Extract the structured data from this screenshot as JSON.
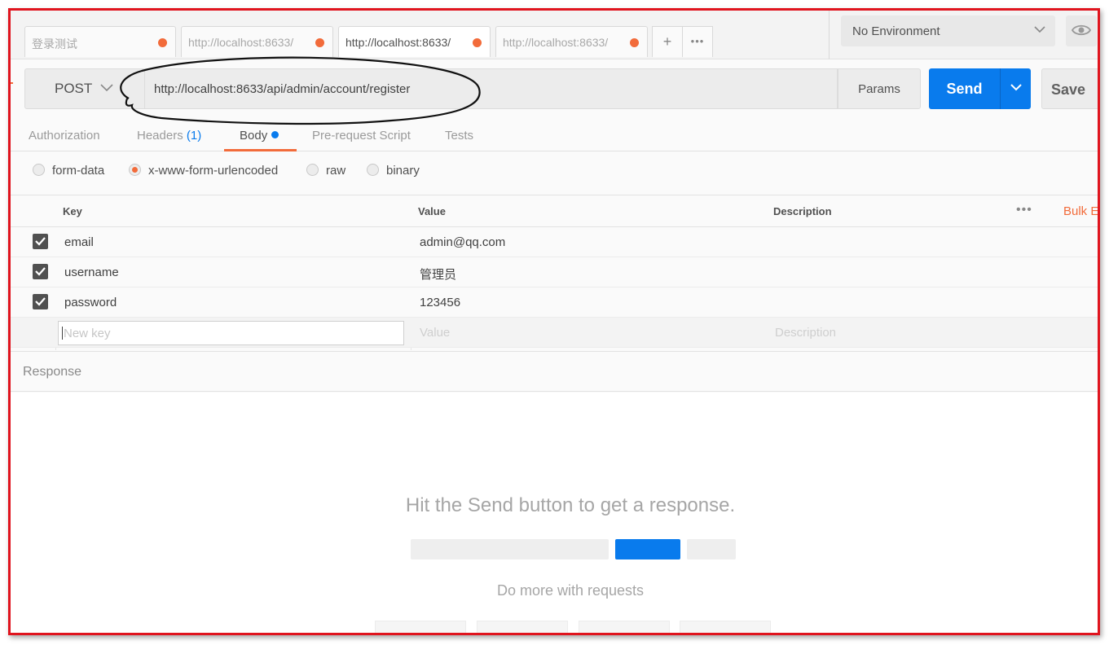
{
  "tabs": [
    {
      "label": "登录测试",
      "unsaved": true,
      "active": false
    },
    {
      "label": "http://localhost:8633/",
      "unsaved": true,
      "active": false
    },
    {
      "label": "http://localhost:8633/",
      "unsaved": true,
      "active": true
    },
    {
      "label": "http://localhost:8633/",
      "unsaved": true,
      "active": false
    }
  ],
  "tab_actions": {
    "new_tab": "+",
    "more": "•••"
  },
  "environment": {
    "selected": "No Environment"
  },
  "request": {
    "method": "POST",
    "url": "http://localhost:8633/api/admin/account/register",
    "params_label": "Params",
    "send_label": "Send",
    "save_label": "Save"
  },
  "request_tabs": [
    {
      "label": "Authorization",
      "count": ""
    },
    {
      "label": "Headers",
      "count": "(1)"
    },
    {
      "label": "Body",
      "count": ""
    },
    {
      "label": "Pre-request Script",
      "count": ""
    },
    {
      "label": "Tests",
      "count": ""
    }
  ],
  "body_types": [
    {
      "label": "form-data",
      "selected": false
    },
    {
      "label": "x-www-form-urlencoded",
      "selected": true
    },
    {
      "label": "raw",
      "selected": false
    },
    {
      "label": "binary",
      "selected": false
    }
  ],
  "kv_table": {
    "headers": {
      "key": "Key",
      "value": "Value",
      "description": "Description",
      "bulk_edit": "Bulk E"
    },
    "rows": [
      {
        "key": "email",
        "value": "admin@qq.com",
        "description": "",
        "checked": true
      },
      {
        "key": "username",
        "value": "管理员",
        "description": "",
        "checked": true
      },
      {
        "key": "password",
        "value": "123456",
        "description": "",
        "checked": true
      }
    ],
    "new_row": {
      "key_placeholder": "New key",
      "value_placeholder": "Value",
      "description_placeholder": "Description"
    }
  },
  "response": {
    "label": "Response",
    "hint": "Hit the Send button to get a response.",
    "more": "Do more with requests"
  },
  "colors": {
    "accent": "#f26b3a",
    "primary": "#097bed",
    "frame": "#e0141e"
  }
}
